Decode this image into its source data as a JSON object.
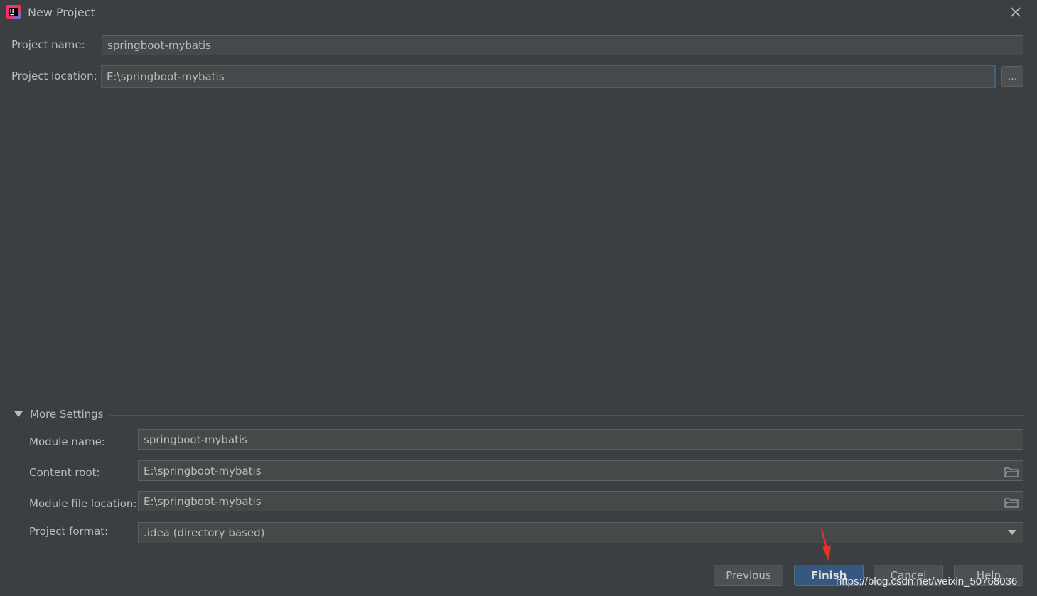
{
  "window": {
    "title": "New Project",
    "app_icon": "intellij-idea-icon",
    "close_icon": "close-icon"
  },
  "form": {
    "project_name_label": "Project name:",
    "project_name_value": "springboot-mybatis",
    "project_location_label": "Project location:",
    "project_location_value": "E:\\springboot-mybatis",
    "browse_label": "..."
  },
  "more_settings": {
    "header": "More Settings",
    "expanded": true,
    "module_name_label": "Module name:",
    "module_name_value": "springboot-mybatis",
    "content_root_label": "Content root:",
    "content_root_value": "E:\\springboot-mybatis",
    "module_file_location_label": "Module file location:",
    "module_file_location_value": "E:\\springboot-mybatis",
    "project_format_label": "Project format:",
    "project_format_value": ".idea (directory based)"
  },
  "buttons": {
    "previous": "Previous",
    "finish": "Finish",
    "cancel": "Cancel",
    "help": "Help"
  },
  "watermark": "https://blog.csdn.net/weixin_50768036",
  "colors": {
    "background": "#3c3f41",
    "field_background": "#45494a",
    "focus_border": "#3d6185",
    "primary_button": "#365880",
    "annotation_arrow": "#e8302c"
  }
}
